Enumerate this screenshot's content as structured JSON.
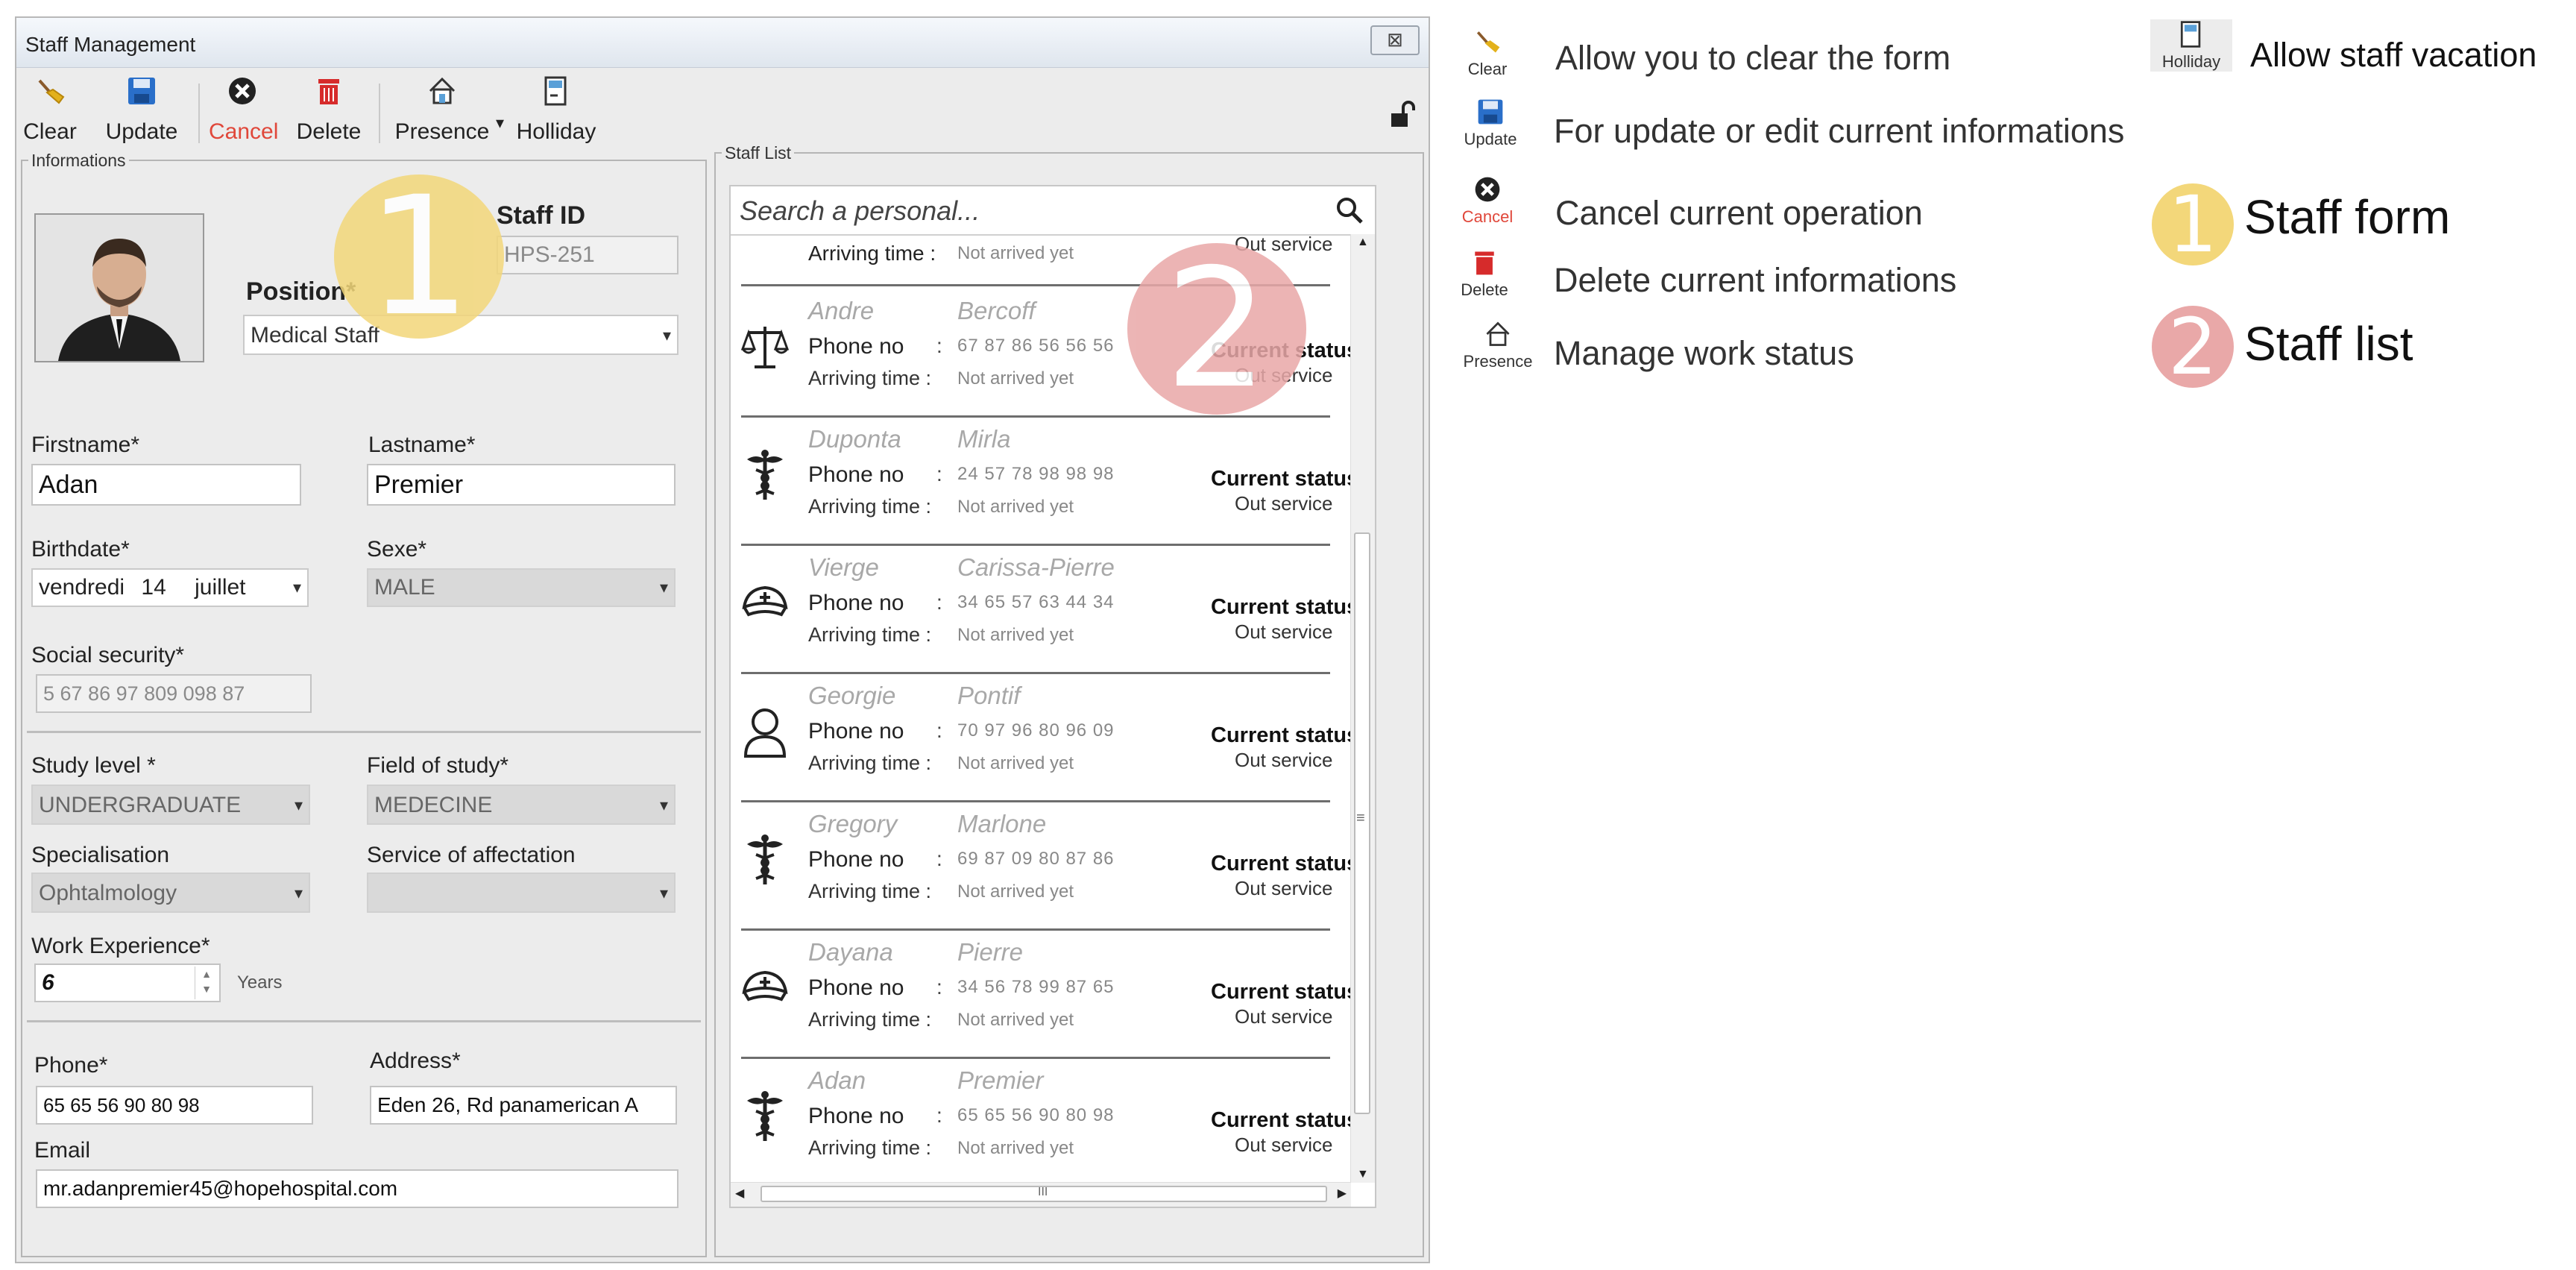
{
  "window": {
    "title": "Staff Management",
    "close_glyph": "⊠"
  },
  "toolbar": {
    "buttons": [
      {
        "label": "Clear",
        "icon": "broom-icon"
      },
      {
        "label": "Update",
        "icon": "save-icon"
      },
      {
        "label": "Cancel",
        "icon": "cancel-icon"
      },
      {
        "label": "Delete",
        "icon": "trash-icon"
      },
      {
        "label": "Presence",
        "icon": "house-icon"
      },
      {
        "label": "Holliday",
        "icon": "door-exit-icon"
      }
    ],
    "dropdown_glyph": "▾"
  },
  "form": {
    "group_title": "Informations",
    "staff_id_label": "Staff ID",
    "staff_id_value": "HPS-251",
    "position_label": "Position*",
    "position_value": "Medical Staff",
    "firstname_label": "Firstname*",
    "firstname_value": "Adan",
    "lastname_label": "Lastname*",
    "lastname_value": "Premier",
    "birthdate_label": "Birthdate*",
    "birthdate_day": "vendredi",
    "birthdate_date": "14",
    "birthdate_month": "juillet",
    "sexe_label": "Sexe*",
    "sexe_value": "MALE",
    "social_label": "Social security*",
    "social_value": "5 67 86 97 809 098 87",
    "study_label": "Study level *",
    "study_value": "UNDERGRADUATE",
    "field_label": "Field of study*",
    "field_value": "MEDECINE",
    "spec_label": "Specialisation",
    "spec_value": "Ophtalmology",
    "service_label": "Service of affectation",
    "service_value": "",
    "work_label": "Work Experience*",
    "work_value": "6",
    "work_unit": "Years",
    "phone_label": "Phone*",
    "phone_value": "65 65 56 90 80 98",
    "address_label": "Address*",
    "address_value": "Eden 26, Rd panamerican A",
    "email_label": "Email",
    "email_value": "mr.adanpremier45@hopehospital.com"
  },
  "staff_list": {
    "group_title": "Staff List",
    "search_placeholder": "Search a personal...",
    "top_partial": {
      "arriving_label": "Arriving time :",
      "arriving": "Not arrived yet",
      "status": "Out service"
    },
    "phone_label": "Phone no",
    "colon": ":",
    "arriving_label": "Arriving time :",
    "status_title": "Current status",
    "scroll_mid_glyph": "≡",
    "hscroll_glyph": "III",
    "items": [
      {
        "first": "Andre",
        "last": "Bercoff",
        "phone": "67 87 86 56 56 56",
        "arriving": "Not arrived yet",
        "status": "Out service",
        "icon": "scales-icon"
      },
      {
        "first": "Duponta",
        "last": "Mirla",
        "phone": "24 57 78 98 98 98",
        "arriving": "Not arrived yet",
        "status": "Out service",
        "icon": "caduceus-icon"
      },
      {
        "first": "Vierge",
        "last": "Carissa-Pierre",
        "phone": "34 65 57 63 44 34",
        "arriving": "Not arrived yet",
        "status": "Out service",
        "icon": "nurse-cap-icon"
      },
      {
        "first": "Georgie",
        "last": "Pontif",
        "phone": "70 97 96 80 96 09",
        "arriving": "Not arrived yet",
        "status": "Out service",
        "icon": "person-icon"
      },
      {
        "first": "Gregory",
        "last": "Marlone",
        "phone": "69 87 09 80 87 86",
        "arriving": "Not arrived yet",
        "status": "Out service",
        "icon": "caduceus-icon"
      },
      {
        "first": "Dayana",
        "last": "Pierre",
        "phone": "34 56 78 99 87 65",
        "arriving": "Not arrived yet",
        "status": "Out service",
        "icon": "nurse-cap-icon"
      },
      {
        "first": "Adan",
        "last": "Premier",
        "phone": "65 65 56 90 80 98",
        "arriving": "Not arrived yet",
        "status": "Out service",
        "icon": "caduceus-icon"
      }
    ]
  },
  "badges": {
    "one": "1",
    "two": "2",
    "color_one": "#f3d77a",
    "color_two": "#e9a8a8"
  },
  "legend": {
    "clear": {
      "icon_label": "Clear",
      "text": "Allow you to clear the form"
    },
    "update": {
      "icon_label": "Update",
      "text": "For update or edit current informations"
    },
    "cancel": {
      "icon_label": "Cancel",
      "text": "Cancel current operation"
    },
    "delete": {
      "icon_label": "Delete",
      "text": "Delete current informations"
    },
    "presence": {
      "icon_label": "Presence",
      "text": "Manage work status"
    },
    "holliday": {
      "icon_label": "Holliday",
      "text": "Allow staff vacation"
    },
    "staff_form": "Staff form",
    "staff_list": "Staff list"
  },
  "colors": {
    "cancel_red": "#e0473a",
    "delete_red": "#d62b2b",
    "save_blue": "#2a6fc9",
    "broom_yellow": "#e3b11b"
  }
}
